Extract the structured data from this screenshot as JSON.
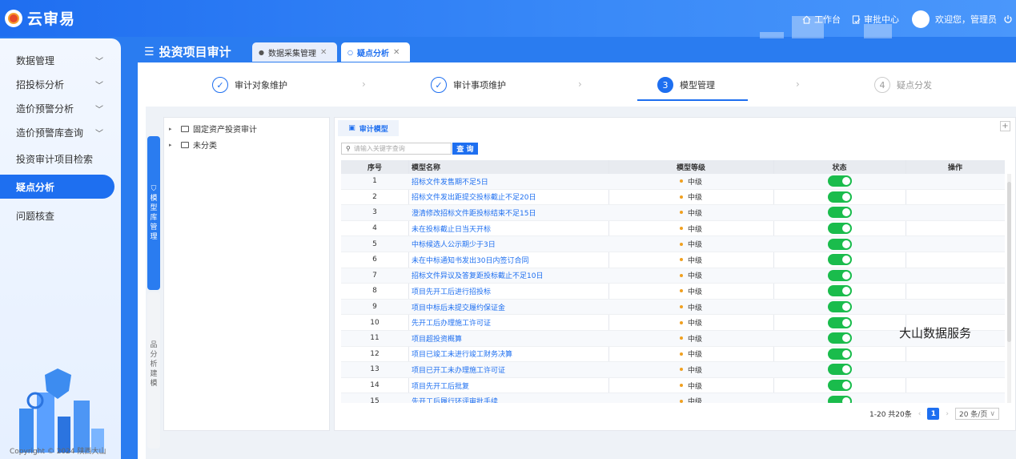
{
  "app": {
    "name": "云审易"
  },
  "topbar": {
    "workbench": "工作台",
    "approval": "审批中心",
    "welcome": "欢迎您，管理员"
  },
  "sidebar": {
    "items": [
      {
        "label": "数据管理",
        "has_children": true
      },
      {
        "label": "招投标分析",
        "has_children": true
      },
      {
        "label": "造价预警分析",
        "has_children": true
      },
      {
        "label": "造价预警库查询",
        "has_children": true
      },
      {
        "label": "投资审计项目检索",
        "has_children": false
      },
      {
        "label": "疑点分析",
        "has_children": false,
        "active": true
      },
      {
        "label": "问题核查",
        "has_children": false
      }
    ],
    "copyright": "Copyright © 2024 陕西大山"
  },
  "header": {
    "title": "投资项目审计",
    "tabs": [
      {
        "label": "数据采集管理"
      },
      {
        "label": "疑点分析",
        "active": true
      }
    ]
  },
  "steps": [
    {
      "num": "1",
      "label": "审计对象维护",
      "status": "done"
    },
    {
      "num": "2",
      "label": "审计事项维护",
      "status": "done"
    },
    {
      "num": "3",
      "label": "模型管理",
      "status": "current"
    },
    {
      "num": "4",
      "label": "疑点分发",
      "status": "todo"
    }
  ],
  "vertical_tabs": [
    {
      "label": "模型库管理",
      "active": true
    },
    {
      "label": "品分析建模",
      "active": false
    }
  ],
  "tree": [
    {
      "label": "固定资产投资审计"
    },
    {
      "label": "未分类"
    }
  ],
  "panel": {
    "tab": "审计模型",
    "search_placeholder": "请输入关键字查询",
    "search_button": "查 询"
  },
  "table": {
    "headers": [
      "序号",
      "模型名称",
      "模型等级",
      "状态",
      "操作"
    ],
    "rows": [
      {
        "no": "1",
        "name": "招标文件发售期不足5日",
        "level": "中级",
        "enabled": true
      },
      {
        "no": "2",
        "name": "招标文件发出距提交投标截止不足20日",
        "level": "中级",
        "enabled": true
      },
      {
        "no": "3",
        "name": "澄清修改招标文件距投标结束不足15日",
        "level": "中级",
        "enabled": true
      },
      {
        "no": "4",
        "name": "未在投标截止日当天开标",
        "level": "中级",
        "enabled": true
      },
      {
        "no": "5",
        "name": "中标候选人公示期少于3日",
        "level": "中级",
        "enabled": true
      },
      {
        "no": "6",
        "name": "未在中标通知书发出30日内签订合同",
        "level": "中级",
        "enabled": true
      },
      {
        "no": "7",
        "name": "招标文件异议及答复距投标截止不足10日",
        "level": "中级",
        "enabled": true
      },
      {
        "no": "8",
        "name": "项目先开工后进行招投标",
        "level": "中级",
        "enabled": true
      },
      {
        "no": "9",
        "name": "项目中标后未提交履约保证金",
        "level": "中级",
        "enabled": true
      },
      {
        "no": "10",
        "name": "先开工后办理施工许可证",
        "level": "中级",
        "enabled": true
      },
      {
        "no": "11",
        "name": "项目超投资概算",
        "level": "中级",
        "enabled": true
      },
      {
        "no": "12",
        "name": "项目已竣工未进行竣工财务决算",
        "level": "中级",
        "enabled": true
      },
      {
        "no": "13",
        "name": "项目已开工未办理施工许可证",
        "level": "中级",
        "enabled": true
      },
      {
        "no": "14",
        "name": "项目先开工后批复",
        "level": "中级",
        "enabled": true
      },
      {
        "no": "15",
        "name": "先开工后履行环评审批手续",
        "level": "中级",
        "enabled": true
      }
    ]
  },
  "pagination": {
    "summary": "1-20 共20条",
    "current": "1",
    "page_size": "20 条/页"
  },
  "watermark": "大山数据服务",
  "colors": {
    "primary": "#1e6ff0",
    "toggle_on": "#1abc4c",
    "level_dot": "#f0a020"
  }
}
